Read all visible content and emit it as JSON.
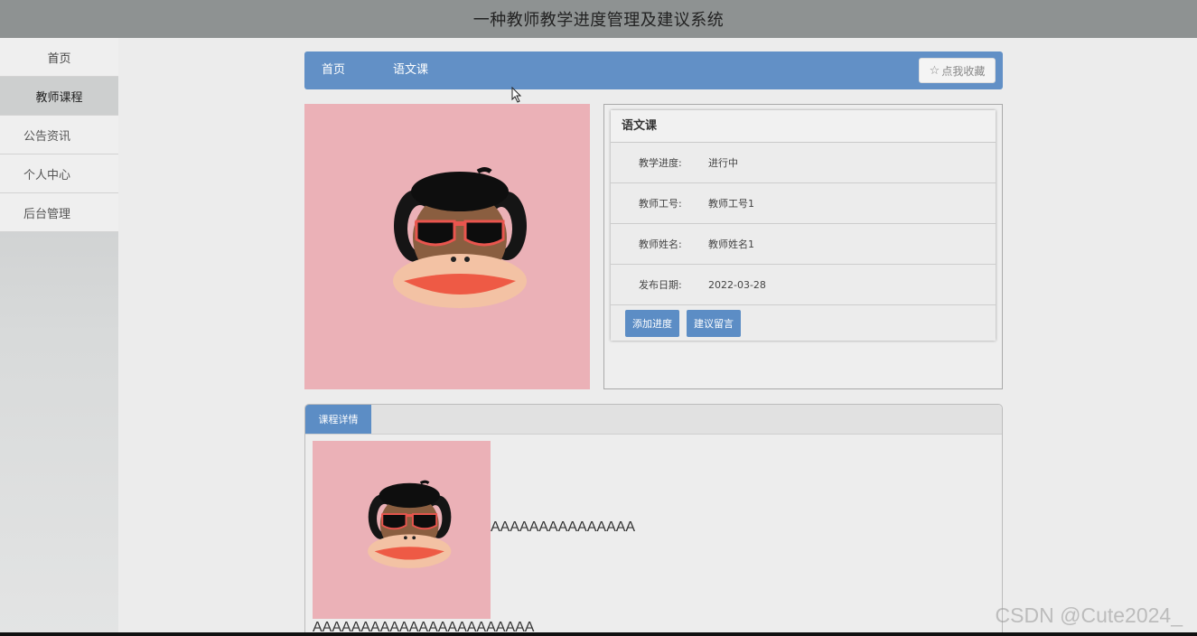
{
  "app": {
    "title": "一种教师教学进度管理及建议系统"
  },
  "sidebar": {
    "items": [
      {
        "label": "首页"
      },
      {
        "label": "教师课程"
      },
      {
        "label": "公告资讯"
      },
      {
        "label": "个人中心"
      },
      {
        "label": "后台管理"
      }
    ]
  },
  "breadcrumb": {
    "home": "首页",
    "current": "语文课"
  },
  "collect": {
    "label": "点我收藏",
    "icon": "star-icon"
  },
  "course": {
    "title": "语文课",
    "fields": [
      {
        "label": "教学进度:",
        "value": "进行中"
      },
      {
        "label": "教师工号:",
        "value": "教师工号1"
      },
      {
        "label": "教师姓名:",
        "value": "教师姓名1"
      },
      {
        "label": "发布日期:",
        "value": "2022-03-28"
      }
    ],
    "buttons": {
      "add_progress": "添加进度",
      "suggest": "建议留言"
    }
  },
  "detail": {
    "tab": "课程详情",
    "text1": "AAAAAAAAAAAAAAA",
    "text2": "AAAAAAAAAAAAAAAAAAAAAAA"
  },
  "watermark": "CSDN @Cute2024_",
  "colors": {
    "header": "#8e9292",
    "nav_blue": "#6290c6",
    "button_blue": "#5c8dc5",
    "image_bg": "#ebb1b7"
  }
}
